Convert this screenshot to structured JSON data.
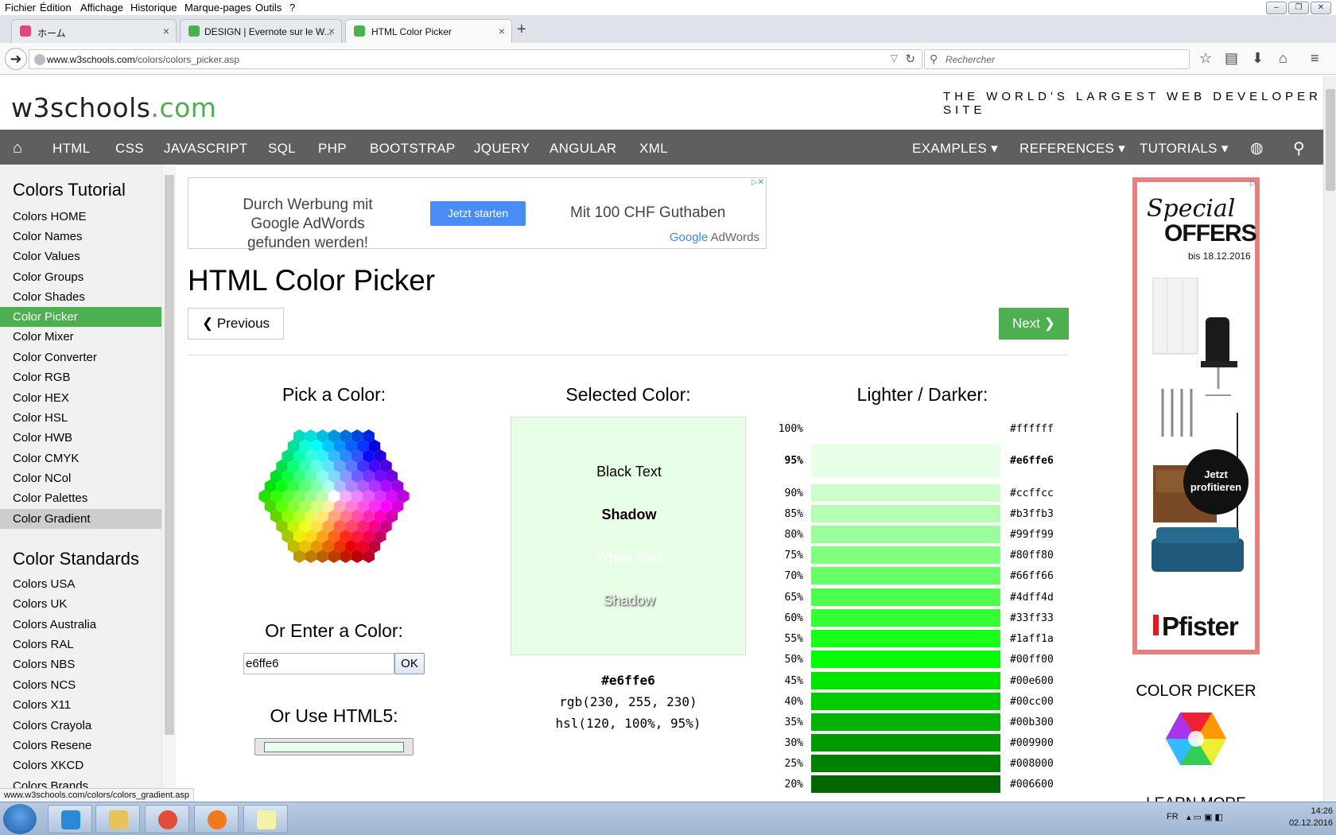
{
  "browser": {
    "menu": [
      "Fichier",
      "Édition",
      "Affichage",
      "Historique",
      "Marque-pages",
      "Outils",
      "?"
    ],
    "tabs": [
      {
        "label": "ホーム",
        "active": false
      },
      {
        "label": "DESIGN | Evernote sur le W...",
        "active": false
      },
      {
        "label": "HTML Color Picker",
        "active": true
      }
    ],
    "url_prefix": "www.w3schools.com",
    "url_path": "/colors/colors_picker.asp",
    "search_placeholder": "Rechercher",
    "status_url": "www.w3schools.com/colors/colors_gradient.asp"
  },
  "site": {
    "logo_main": "w3schools",
    "logo_tld": ".com",
    "tagline": "THE WORLD'S LARGEST WEB DEVELOPER SITE",
    "topnav": [
      "HTML",
      "CSS",
      "JAVASCRIPT",
      "SQL",
      "PHP",
      "BOOTSTRAP",
      "JQUERY",
      "ANGULAR",
      "XML"
    ],
    "topnav_right": [
      "EXAMPLES ▾",
      "REFERENCES ▾",
      "TUTORIALS ▾"
    ]
  },
  "sidebar": {
    "heading1": "Colors Tutorial",
    "items1": [
      "Colors HOME",
      "Color Names",
      "Color Values",
      "Color Groups",
      "Color Shades",
      "Color Picker",
      "Color Mixer",
      "Color Converter",
      "Color RGB",
      "Color HEX",
      "Color HSL",
      "Color HWB",
      "Color CMYK",
      "Color NCol",
      "Color Palettes",
      "Color Gradient"
    ],
    "active": "Color Picker",
    "hover": "Color Gradient",
    "heading2": "Color Standards",
    "items2": [
      "Colors USA",
      "Colors UK",
      "Colors Australia",
      "Colors RAL",
      "Colors NBS",
      "Colors NCS",
      "Colors X11",
      "Colors Crayola",
      "Colors Resene",
      "Colors XKCD",
      "Colors Brands"
    ]
  },
  "ad_top": {
    "left_text": "Durch Werbung mit Google AdWords gefunden werden!",
    "button": "Jetzt starten",
    "right_text": "Mit 100 CHF Guthaben",
    "brand_google": "Google",
    "brand_adwords": " AdWords"
  },
  "main": {
    "title": "HTML Color Picker",
    "prev_label": "❮ Previous",
    "next_label": "Next ❯",
    "pick_heading": "Pick a Color:",
    "enter_heading": "Or Enter a Color:",
    "enter_value": "e6ffe6",
    "ok_label": "OK",
    "html5_heading": "Or Use HTML5:",
    "html5_color": "#e6ffe6",
    "selected_heading": "Selected Color:",
    "selected_color": "#e6ffe6",
    "sample_black": "Black Text",
    "sample_shadow1": "Shadow",
    "sample_white": "White Text",
    "sample_shadow2": "Shadow",
    "sel_hex": "#e6ffe6",
    "sel_rgb": "rgb(230, 255, 230)",
    "sel_hsl": "hsl(120, 100%, 95%)",
    "ld_heading": "Lighter / Darker:",
    "ld_rows": [
      {
        "pct": "100%",
        "hex": "#ffffff",
        "bold": false
      },
      {
        "pct": "95%",
        "hex": "#e6ffe6",
        "bold": true
      },
      {
        "pct": "90%",
        "hex": "#ccffcc",
        "bold": false
      },
      {
        "pct": "85%",
        "hex": "#b3ffb3",
        "bold": false
      },
      {
        "pct": "80%",
        "hex": "#99ff99",
        "bold": false
      },
      {
        "pct": "75%",
        "hex": "#80ff80",
        "bold": false
      },
      {
        "pct": "70%",
        "hex": "#66ff66",
        "bold": false
      },
      {
        "pct": "65%",
        "hex": "#4dff4d",
        "bold": false
      },
      {
        "pct": "60%",
        "hex": "#33ff33",
        "bold": false
      },
      {
        "pct": "55%",
        "hex": "#1aff1a",
        "bold": false
      },
      {
        "pct": "50%",
        "hex": "#00ff00",
        "bold": false
      },
      {
        "pct": "45%",
        "hex": "#00e600",
        "bold": false
      },
      {
        "pct": "40%",
        "hex": "#00cc00",
        "bold": false
      },
      {
        "pct": "35%",
        "hex": "#00b300",
        "bold": false
      },
      {
        "pct": "30%",
        "hex": "#009900",
        "bold": false
      },
      {
        "pct": "25%",
        "hex": "#008000",
        "bold": false
      },
      {
        "pct": "20%",
        "hex": "#006600",
        "bold": false
      }
    ]
  },
  "ad_right": {
    "special": "Special",
    "offers": "OFFERS",
    "until": "bis 18.12.2016",
    "cta": "Jetzt profitieren",
    "brand": "Pfister"
  },
  "right_col": {
    "picker_title": "COLOR PICKER",
    "learn_more": "LEARN MORE"
  },
  "taskbar": {
    "lang": "FR",
    "time": "14:26",
    "date": "02.12.2016"
  },
  "colors": {
    "brand_green": "#4caf50",
    "nav_bg": "#5f5f5f"
  }
}
